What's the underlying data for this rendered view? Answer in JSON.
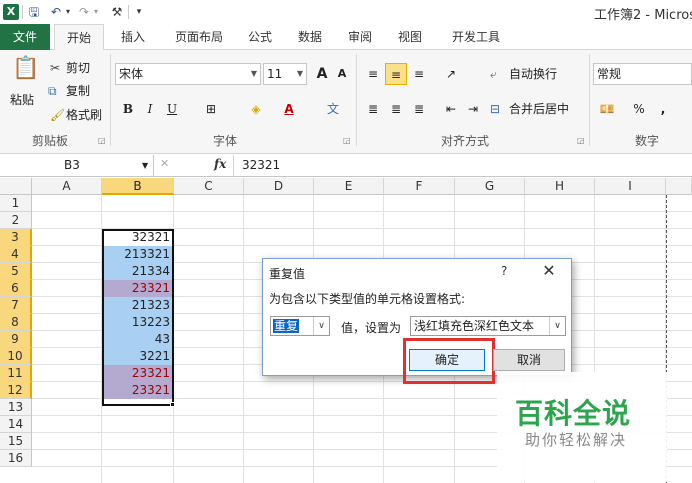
{
  "window": {
    "title": "工作簿2 - Micros"
  },
  "quick_access": {
    "app_icon": "X",
    "save": "🖫",
    "undo": "↶",
    "redo": "↷",
    "custom": "⚒",
    "more": "▾",
    "dd": "▾"
  },
  "tabs": [
    {
      "label": "文件"
    },
    {
      "label": "开始"
    },
    {
      "label": "插入"
    },
    {
      "label": "页面布局"
    },
    {
      "label": "公式"
    },
    {
      "label": "数据"
    },
    {
      "label": "审阅"
    },
    {
      "label": "视图"
    },
    {
      "label": "开发工具"
    }
  ],
  "ribbon": {
    "clipboard": {
      "label": "剪贴板",
      "paste": "粘贴",
      "cut": "剪切",
      "copy": "复制",
      "format_painter": "格式刷"
    },
    "font": {
      "label": "字体",
      "name": "宋体",
      "size": "11",
      "grow": "A",
      "shrink": "A",
      "bold": "B",
      "italic": "I",
      "underline": "U",
      "phonetic": "文"
    },
    "alignment": {
      "label": "对齐方式",
      "wrap": "自动换行",
      "merge": "合并后居中"
    },
    "number": {
      "label": "数字",
      "format": "常规",
      "percent": "%",
      "comma": ","
    }
  },
  "formula_bar": {
    "name_box": "B3",
    "fx": "fx",
    "cancel": "✕",
    "value": "32321"
  },
  "grid": {
    "columns": [
      "A",
      "B",
      "C",
      "D",
      "E",
      "F",
      "G",
      "H",
      "I"
    ],
    "rows": [
      "1",
      "2",
      "3",
      "4",
      "5",
      "6",
      "7",
      "8",
      "9",
      "10",
      "11",
      "12",
      "13",
      "14",
      "15",
      "16"
    ],
    "cells": [
      {
        "row": 3,
        "value": "32321",
        "dup": false
      },
      {
        "row": 4,
        "value": "213321",
        "dup": false
      },
      {
        "row": 5,
        "value": "21334",
        "dup": false
      },
      {
        "row": 6,
        "value": "23321",
        "dup": true
      },
      {
        "row": 7,
        "value": "21323",
        "dup": false
      },
      {
        "row": 8,
        "value": "13223",
        "dup": false
      },
      {
        "row": 9,
        "value": "43",
        "dup": false
      },
      {
        "row": 10,
        "value": "3221",
        "dup": false
      },
      {
        "row": 11,
        "value": "23321",
        "dup": true
      },
      {
        "row": 12,
        "value": "23321",
        "dup": true
      }
    ],
    "selected_column": "B",
    "colors": {
      "selected_range_fill": "#a9cff2",
      "duplicate_fill": "#b4a9cf",
      "duplicate_text": "#9c0006"
    }
  },
  "dialog": {
    "title": "重复值",
    "help": "?",
    "close": "✕",
    "description": "为包含以下类型值的单元格设置格式:",
    "type_value": "重复",
    "middle_label": "值，设置为",
    "format_value": "浅红填充色深红色文本",
    "ok_label": "确定",
    "cancel_label": "取消",
    "highlight_color": "#e03030"
  },
  "watermark": {
    "title": "百科全说",
    "subtitle": "助你轻松解决"
  }
}
